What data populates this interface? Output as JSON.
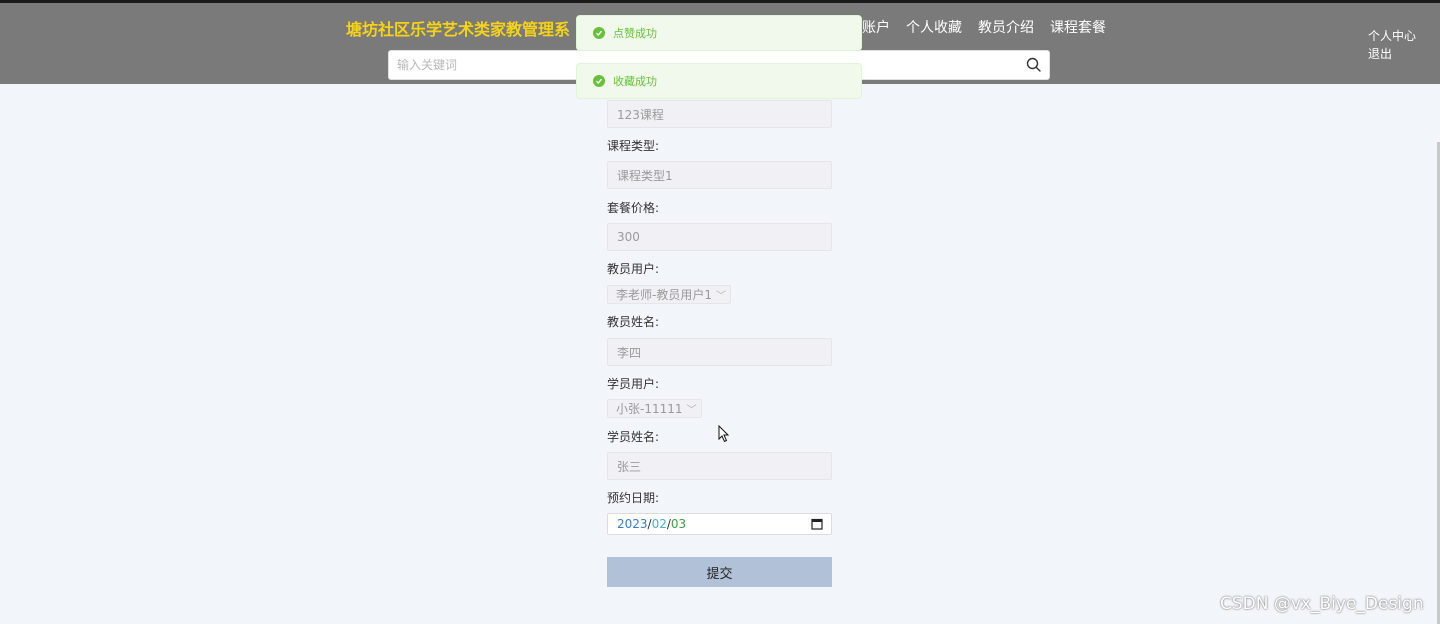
{
  "header": {
    "brand": "塘坊社区乐学艺术类家教管理系",
    "nav": [
      "账户",
      "个人收藏",
      "教员介绍",
      "课程套餐"
    ],
    "user_links": {
      "profile": "个人中心",
      "logout": "退出"
    }
  },
  "search": {
    "placeholder": "输入关键词"
  },
  "toasts": [
    "点赞成功",
    "收藏成功"
  ],
  "form": {
    "course_name_value": "123课程",
    "course_type": {
      "label": "课程类型:",
      "value": "课程类型1"
    },
    "price": {
      "label": "套餐价格:",
      "value": "300"
    },
    "teacher_user": {
      "label": "教员用户:",
      "value": "李老师-教员用户1"
    },
    "teacher_name": {
      "label": "教员姓名:",
      "value": "李四"
    },
    "student_user": {
      "label": "学员用户:",
      "value": "小张-11111"
    },
    "student_name": {
      "label": "学员姓名:",
      "value": "张三"
    },
    "date": {
      "label": "预约日期:",
      "year": "2023",
      "month": "02",
      "day": "03"
    },
    "submit_label": "提交"
  },
  "watermark": "CSDN @vx_Biye_Design",
  "colors": {
    "header_bg": "#7a7a7a",
    "brand": "#f5d316",
    "success": "#67c23a",
    "submit_bg": "#b0c1d8"
  }
}
